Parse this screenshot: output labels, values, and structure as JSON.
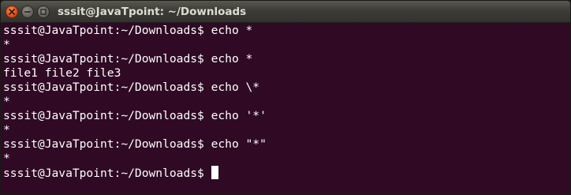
{
  "window": {
    "title": "sssit@JavaTpoint: ~/Downloads",
    "buttons": {
      "close_icon": "close-icon",
      "minimize_icon": "minimize-icon",
      "maximize_icon": "maximize-icon"
    }
  },
  "terminal": {
    "colors": {
      "background": "#300a24",
      "foreground": "#ffffff",
      "close_button": "#e3541d"
    },
    "lines": [
      "sssit@JavaTpoint:~/Downloads$ echo *",
      "*",
      "sssit@JavaTpoint:~/Downloads$ echo *",
      "file1 file2 file3",
      "sssit@JavaTpoint:~/Downloads$ echo \\*",
      "*",
      "sssit@JavaTpoint:~/Downloads$ echo '*'",
      "*",
      "sssit@JavaTpoint:~/Downloads$ echo \"*\"",
      "*"
    ],
    "prompt": "sssit@JavaTpoint:~/Downloads$ "
  }
}
